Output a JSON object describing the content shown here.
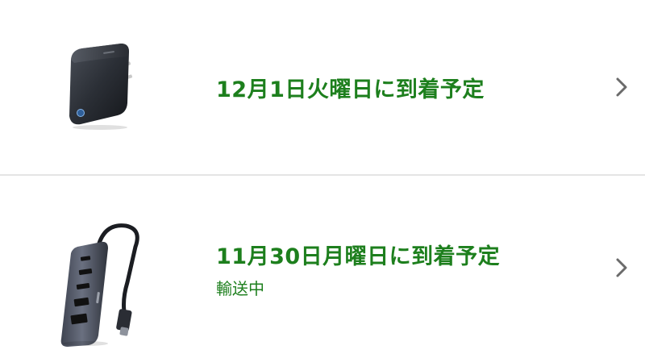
{
  "orders": [
    {
      "delivery_status": "12月1日火曜日に到着予定",
      "sub_status": "",
      "product_image": "power-bank-charger-image",
      "chevron_icon": "chevron-right-icon"
    },
    {
      "delivery_status": "11月30日月曜日に到着予定",
      "sub_status": "輸送中",
      "product_image": "usb-c-hub-image",
      "chevron_icon": "chevron-right-icon"
    }
  ],
  "colors": {
    "status_green": "#1d7f1d",
    "divider": "#e4e4e4",
    "chevron": "#6b6b6b"
  }
}
